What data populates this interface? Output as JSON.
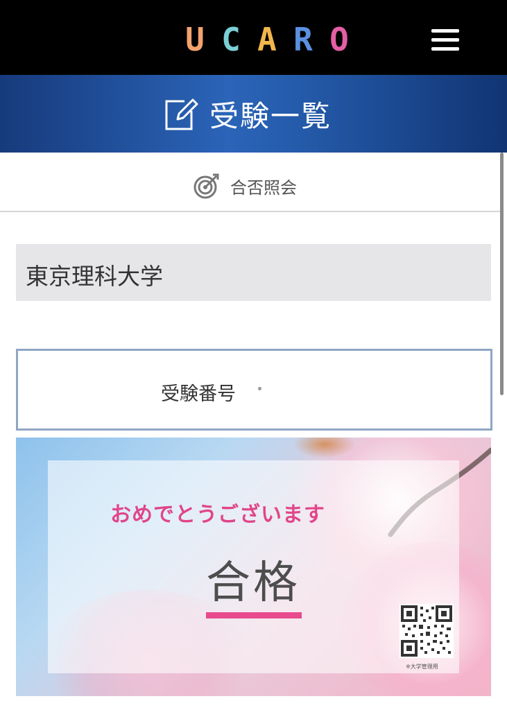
{
  "topbar": {
    "logo_letters": [
      "U",
      "C",
      "A",
      "R",
      "O"
    ],
    "logo_colors": [
      "#f2a36e",
      "#7bcfd6",
      "#f2b64c",
      "#5b8fe0",
      "#e45fa5"
    ],
    "menu_icon": "hamburger-menu-icon"
  },
  "header": {
    "icon": "edit-note-icon",
    "title": "受験一覧"
  },
  "tab": {
    "icon": "target-icon",
    "label": "合否照会"
  },
  "university": {
    "name": "東京理科大学"
  },
  "exam": {
    "label": "受験番号"
  },
  "result": {
    "message": "おめでとうございます",
    "status": "合格",
    "qr_note": "※大学管理用",
    "accent_color": "#e0468a"
  }
}
